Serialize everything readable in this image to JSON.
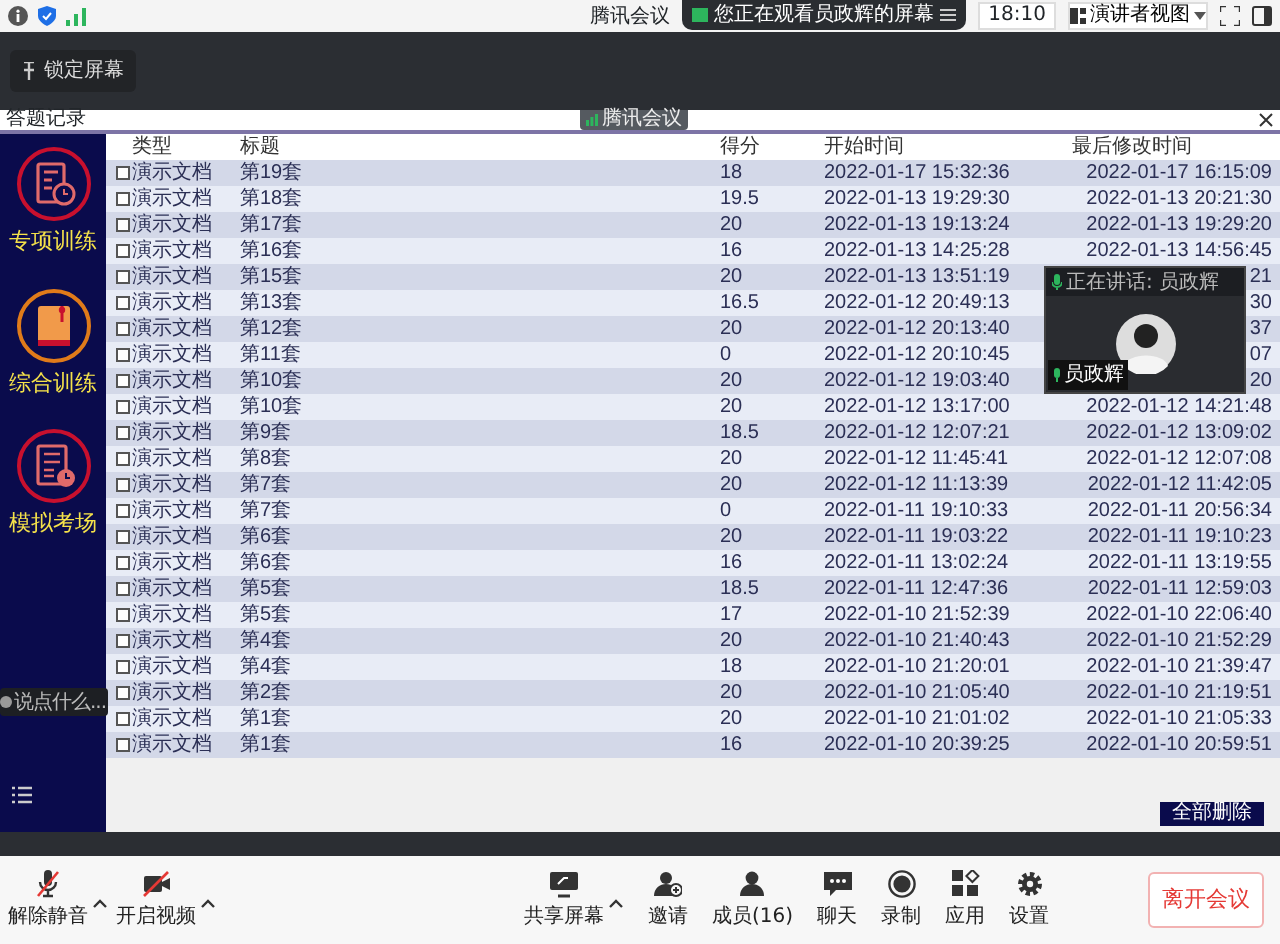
{
  "top_bar": {
    "title": "腾讯会议",
    "sharing_notice": "您正在观看员政辉的屏幕",
    "time": "18:10",
    "view_mode": "演讲者视图"
  },
  "lock_screen": "锁定屏幕",
  "shared_window": {
    "title": "答题记录",
    "overlay_badge": "腾讯会议",
    "sidebar": [
      {
        "label": "专项训练",
        "kind": "doc-clock"
      },
      {
        "label": "综合训练",
        "kind": "book"
      },
      {
        "label": "模拟考场",
        "kind": "exam"
      }
    ],
    "columns": [
      "类型",
      "标题",
      "得分",
      "开始时间",
      "最后修改时间"
    ],
    "rows": [
      {
        "checked": false,
        "cells": [
          "演示文档",
          "第19套",
          "18",
          "2022-01-17 15:32:36",
          "2022-01-17 16:15:09"
        ]
      },
      {
        "checked": false,
        "cells": [
          "演示文档",
          "第18套",
          "19.5",
          "2022-01-13 19:29:30",
          "2022-01-13 20:21:30"
        ]
      },
      {
        "checked": false,
        "cells": [
          "演示文档",
          "第17套",
          "20",
          "2022-01-13 19:13:24",
          "2022-01-13 19:29:20"
        ]
      },
      {
        "checked": false,
        "cells": [
          "演示文档",
          "第16套",
          "16",
          "2022-01-13 14:25:28",
          "2022-01-13 14:56:45"
        ]
      },
      {
        "checked": false,
        "cells": [
          "演示文档",
          "第15套",
          "20",
          "2022-01-13 13:51:19",
          "21"
        ]
      },
      {
        "checked": false,
        "cells": [
          "演示文档",
          "第13套",
          "16.5",
          "2022-01-12 20:49:13",
          "30"
        ]
      },
      {
        "checked": false,
        "cells": [
          "演示文档",
          "第12套",
          "20",
          "2022-01-12 20:13:40",
          "37"
        ]
      },
      {
        "checked": false,
        "cells": [
          "演示文档",
          "第11套",
          "0",
          "2022-01-12 20:10:45",
          "07"
        ]
      },
      {
        "checked": false,
        "cells": [
          "演示文档",
          "第10套",
          "20",
          "2022-01-12 19:03:40",
          "20"
        ]
      },
      {
        "checked": false,
        "cells": [
          "演示文档",
          "第10套",
          "20",
          "2022-01-12 13:17:00",
          "2022-01-12 14:21:48"
        ]
      },
      {
        "checked": false,
        "cells": [
          "演示文档",
          "第9套",
          "18.5",
          "2022-01-12 12:07:21",
          "2022-01-12 13:09:02"
        ]
      },
      {
        "checked": false,
        "cells": [
          "演示文档",
          "第8套",
          "20",
          "2022-01-12 11:45:41",
          "2022-01-12 12:07:08"
        ]
      },
      {
        "checked": false,
        "cells": [
          "演示文档",
          "第7套",
          "20",
          "2022-01-12 11:13:39",
          "2022-01-12 11:42:05"
        ]
      },
      {
        "checked": false,
        "cells": [
          "演示文档",
          "第7套",
          "0",
          "2022-01-11 19:10:33",
          "2022-01-11 20:56:34"
        ]
      },
      {
        "checked": false,
        "cells": [
          "演示文档",
          "第6套",
          "20",
          "2022-01-11 19:03:22",
          "2022-01-11 19:10:23"
        ]
      },
      {
        "checked": false,
        "cells": [
          "演示文档",
          "第6套",
          "16",
          "2022-01-11 13:02:24",
          "2022-01-11 13:19:55"
        ]
      },
      {
        "checked": false,
        "cells": [
          "演示文档",
          "第5套",
          "18.5",
          "2022-01-11 12:47:36",
          "2022-01-11 12:59:03"
        ]
      },
      {
        "checked": false,
        "cells": [
          "演示文档",
          "第5套",
          "17",
          "2022-01-10 21:52:39",
          "2022-01-10 22:06:40"
        ]
      },
      {
        "checked": false,
        "cells": [
          "演示文档",
          "第4套",
          "20",
          "2022-01-10 21:40:43",
          "2022-01-10 21:52:29"
        ]
      },
      {
        "checked": false,
        "cells": [
          "演示文档",
          "第4套",
          "18",
          "2022-01-10 21:20:01",
          "2022-01-10 21:39:47"
        ]
      },
      {
        "checked": false,
        "cells": [
          "演示文档",
          "第2套",
          "20",
          "2022-01-10 21:05:40",
          "2022-01-10 21:19:51"
        ]
      },
      {
        "checked": false,
        "cells": [
          "演示文档",
          "第1套",
          "20",
          "2022-01-10 21:01:02",
          "2022-01-10 21:05:33"
        ]
      },
      {
        "checked": false,
        "cells": [
          "演示文档",
          "第1套",
          "16",
          "2022-01-10 20:39:25",
          "2022-01-10 20:59:51"
        ]
      }
    ],
    "delete_all": "全部删除"
  },
  "chat_input": {
    "placeholder": "说点什么..."
  },
  "speaker_tile": {
    "speaking": "正在讲话: 员政辉",
    "name": "员政辉"
  },
  "toolbar": [
    {
      "label": "解除静音",
      "kind": "mic-off",
      "caret": true
    },
    {
      "label": "开启视频",
      "kind": "camera-off",
      "caret": true
    },
    {
      "label": "共享屏幕",
      "kind": "screen",
      "caret": true
    },
    {
      "label": "邀请",
      "kind": "invite",
      "caret": false
    },
    {
      "label": "成员(16)",
      "kind": "members",
      "caret": false
    },
    {
      "label": "聊天",
      "kind": "chat",
      "caret": false
    },
    {
      "label": "录制",
      "kind": "record",
      "caret": false
    },
    {
      "label": "应用",
      "kind": "apps",
      "caret": false
    },
    {
      "label": "设置",
      "kind": "settings",
      "caret": false
    }
  ],
  "leave_button": "离开会议"
}
